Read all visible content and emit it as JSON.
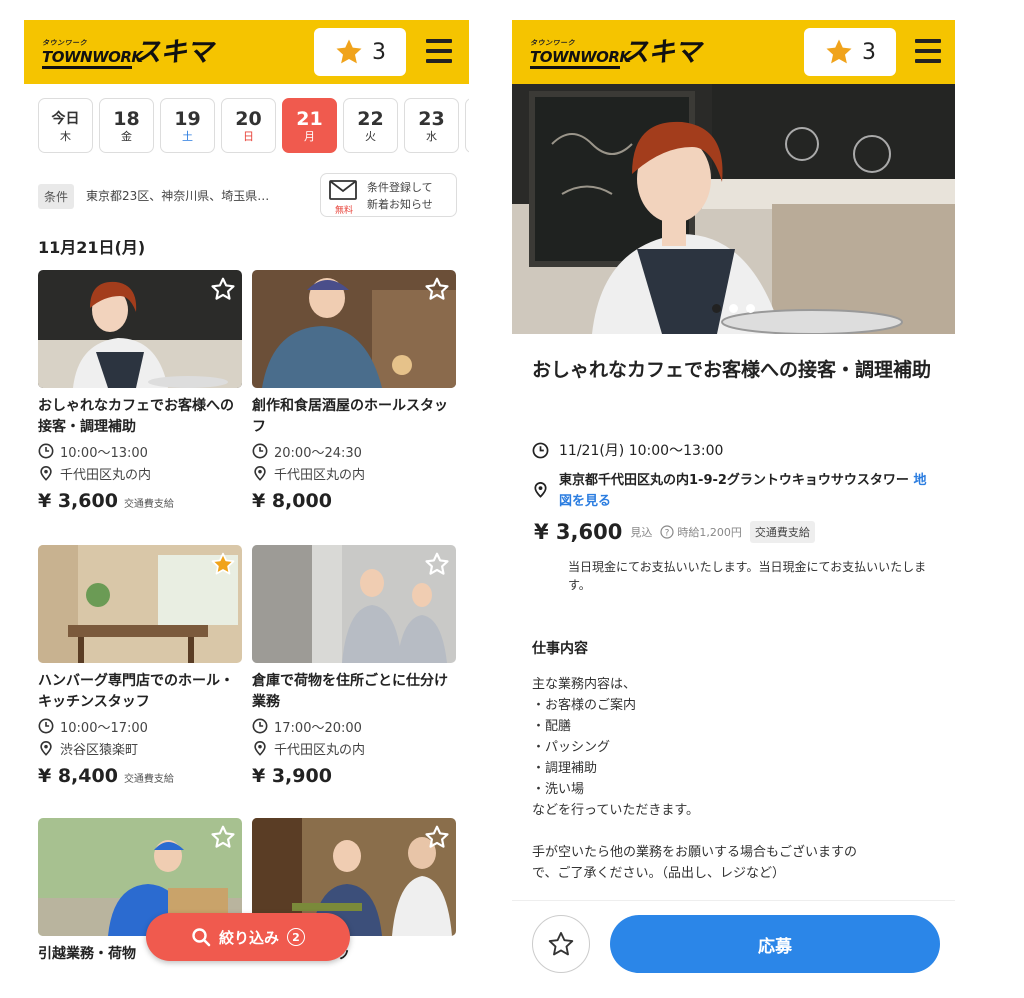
{
  "brand": {
    "small": "タウンワーク",
    "main": "TOWNWORK",
    "big": "スキマ"
  },
  "header": {
    "fav_count": "3"
  },
  "dates": [
    {
      "num": "今日",
      "dow": "木",
      "kind": "first"
    },
    {
      "num": "18",
      "dow": "金",
      "kind": ""
    },
    {
      "num": "19",
      "dow": "土",
      "kind": "sat"
    },
    {
      "num": "20",
      "dow": "日",
      "kind": "sun"
    },
    {
      "num": "21",
      "dow": "月",
      "kind": "active"
    },
    {
      "num": "22",
      "dow": "火",
      "kind": ""
    },
    {
      "num": "23",
      "dow": "水",
      "kind": ""
    }
  ],
  "conditions": {
    "tag": "条件",
    "text": "東京都23区、神奈川県、埼玉県…",
    "notify_line1": "条件登録して",
    "notify_line2": "新着お知らせ",
    "notify_free": "無料"
  },
  "section_date": "11月21日(月)",
  "jobs": [
    {
      "title": "おしゃれなカフェでお客様への接客・調理補助",
      "time": "10:00〜13:00",
      "place": "千代田区丸の内",
      "price": "¥ 3,600",
      "note": "交通費支給",
      "favorited": false
    },
    {
      "title": "創作和食居酒屋のホールスタッフ",
      "time": "20:00〜24:30",
      "place": "千代田区丸の内",
      "price": "¥ 8,000",
      "note": "",
      "favorited": false
    },
    {
      "title": "ハンバーグ専門店でのホール・キッチンスタッフ",
      "time": "10:00〜17:00",
      "place": "渋谷区猿楽町",
      "price": "¥ 8,400",
      "note": "交通費支給",
      "favorited": true
    },
    {
      "title": "倉庫で荷物を住所ごとに仕分け業務",
      "time": "17:00〜20:00",
      "place": "千代田区丸の内",
      "price": "¥ 3,900",
      "note": "",
      "favorited": false
    },
    {
      "title": "引越業務・荷物",
      "time": "",
      "place": "",
      "price": "",
      "note": "",
      "favorited": false
    },
    {
      "title": "調理補助スタッ",
      "time": "",
      "place": "",
      "price": "",
      "note": "",
      "favorited": false
    }
  ],
  "filter": {
    "label": "絞り込み",
    "count": "2"
  },
  "detail": {
    "title": "おしゃれなカフェでお客様への接客・調理補助",
    "datetime": "11/21(月) 10:00〜13:00",
    "address": "東京都千代田区丸の内1-9-2グラントウキョウサウスタワー",
    "map_link": "地図を見る",
    "price": "¥ 3,600",
    "price_est": "見込",
    "hourly": "時給1,200円",
    "transport": "交通費支給",
    "pay_note": "当日現金にてお支払いいたします。当日現金にてお支払いいたします。",
    "section_heading": "仕事内容",
    "description_lines": [
      "主な業務内容は、",
      "・お客様のご案内",
      "・配膳",
      "・パッシング",
      "・調理補助",
      "・洗い場",
      "などを行っていただきます。",
      "",
      "手が空いたら他の業務をお願いする場合もございますの",
      "で、ご了承ください。（品出し、レジなど）"
    ],
    "apply_label": "応募",
    "carousel_index": 0,
    "carousel_total": 3
  },
  "colors": {
    "brand_yellow": "#f5c400",
    "accent_red": "#f05a4e",
    "apply_blue": "#2b86e8",
    "star_orange": "#f0a31b"
  }
}
